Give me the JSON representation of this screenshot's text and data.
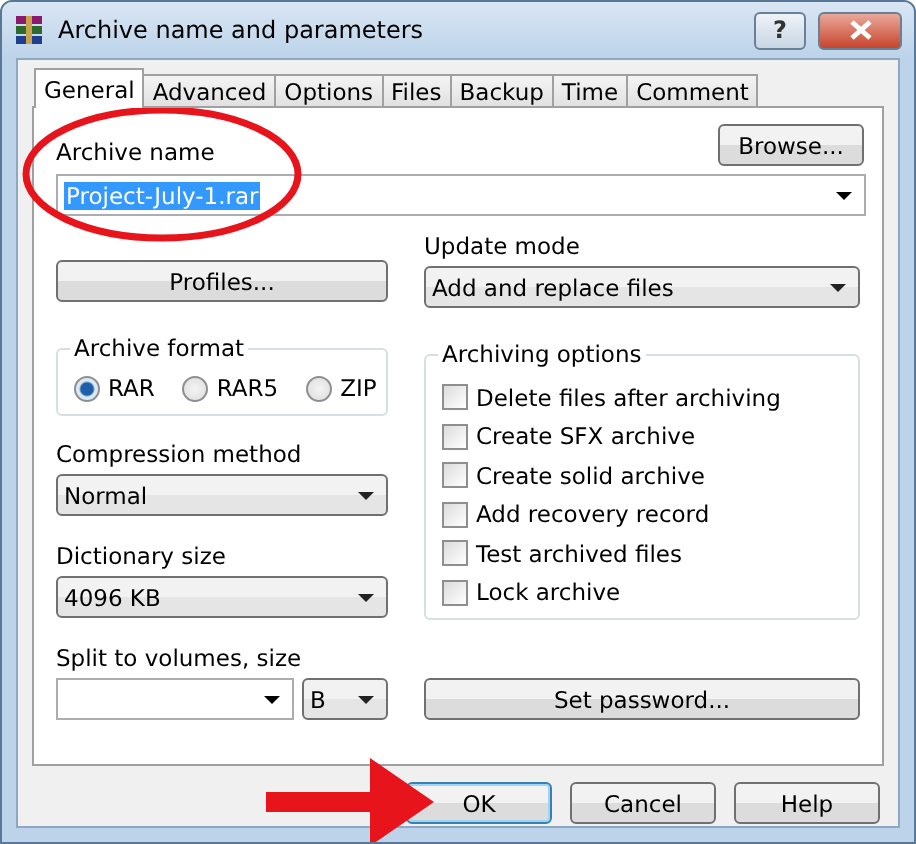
{
  "window": {
    "title": "Archive name and parameters",
    "help": "?"
  },
  "tabs": [
    {
      "label": "General",
      "selected": true
    },
    {
      "label": "Advanced",
      "selected": false
    },
    {
      "label": "Options",
      "selected": false
    },
    {
      "label": "Files",
      "selected": false
    },
    {
      "label": "Backup",
      "selected": false
    },
    {
      "label": "Time",
      "selected": false
    },
    {
      "label": "Comment",
      "selected": false
    }
  ],
  "archive_name": {
    "label": "Archive name",
    "value": "Project-July-1.rar",
    "text_selected": true,
    "browse_button": "Browse..."
  },
  "profiles_button": "Profiles...",
  "update_mode": {
    "label": "Update mode",
    "value": "Add and replace files"
  },
  "archive_format": {
    "title": "Archive format",
    "options": [
      {
        "label": "RAR",
        "selected": true
      },
      {
        "label": "RAR5",
        "selected": false
      },
      {
        "label": "ZIP",
        "selected": false
      }
    ]
  },
  "archiving_options": {
    "title": "Archiving options",
    "items": [
      {
        "label": "Delete files after archiving",
        "checked": false
      },
      {
        "label": "Create SFX archive",
        "checked": false
      },
      {
        "label": "Create solid archive",
        "checked": false
      },
      {
        "label": "Add recovery record",
        "checked": false
      },
      {
        "label": "Test archived files",
        "checked": false
      },
      {
        "label": "Lock archive",
        "checked": false
      }
    ]
  },
  "compression_method": {
    "label": "Compression method",
    "value": "Normal"
  },
  "dictionary_size": {
    "label": "Dictionary size",
    "value": "4096 KB"
  },
  "split_volumes": {
    "label": "Split to volumes, size",
    "unit": "B"
  },
  "set_password_button": "Set password...",
  "buttons": [
    {
      "label": "OK",
      "focused": true
    },
    {
      "label": "Cancel",
      "focused": false
    },
    {
      "label": "Help",
      "focused": false
    }
  ]
}
